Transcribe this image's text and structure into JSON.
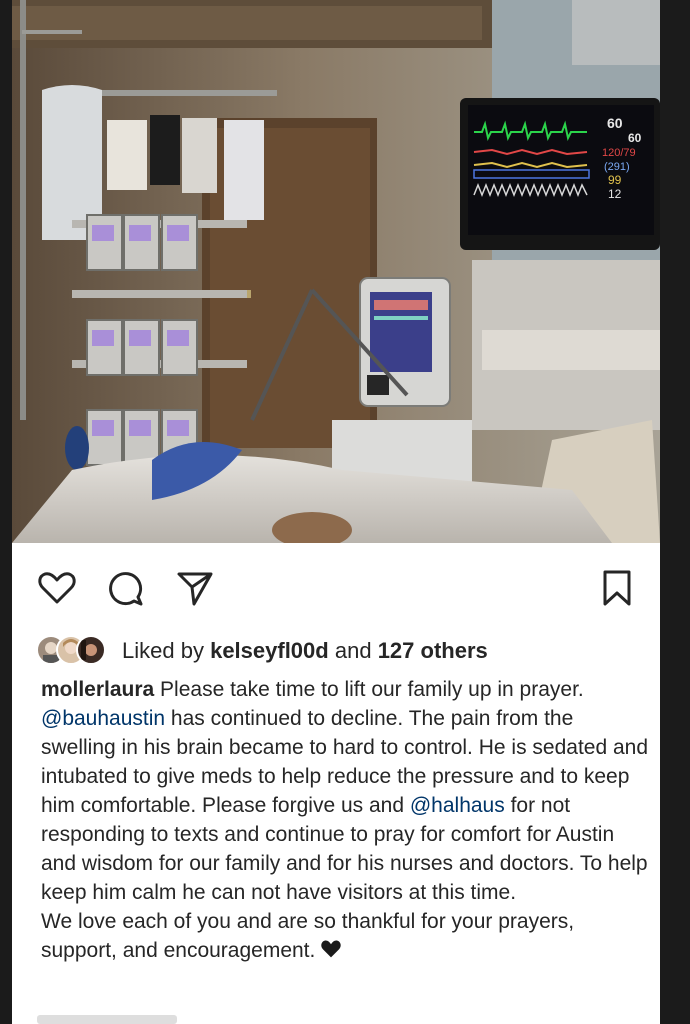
{
  "post": {
    "likes": {
      "prefix": "Liked by",
      "liker": "kelseyfl00d",
      "connector": "and",
      "others": "127 others"
    },
    "caption": {
      "username": "mollerlaura",
      "part1": " Please take time to lift our family up in prayer. ",
      "mention1": "@bauhaustin",
      "part2": " has continued to decline. The pain from the swelling in his brain became to hard to control. He is sedated and intubated  to give meds to help reduce the pressure and to keep him comfortable. Please forgive us and ",
      "mention2": "@halhaus",
      "part3": " for not responding to texts and continue to pray for comfort for Austin and wisdom for our family and for his nurses and doctors. To help keep him calm he can not have visitors at this time.",
      "line2": "We love each of you and are so thankful for your prayers, support, and encouragement."
    }
  },
  "monitor": {
    "hr": "60",
    "hr2": "60",
    "bp": "120/79",
    "sub": "(291)",
    "spo2": "99",
    "rr": "12"
  },
  "colors": {
    "text": "#262626",
    "mention": "#003569",
    "frame": "#1b1b1b"
  },
  "icons": [
    "heart-icon",
    "comment-icon",
    "share-icon",
    "bookmark-icon",
    "black-heart-emoji"
  ]
}
